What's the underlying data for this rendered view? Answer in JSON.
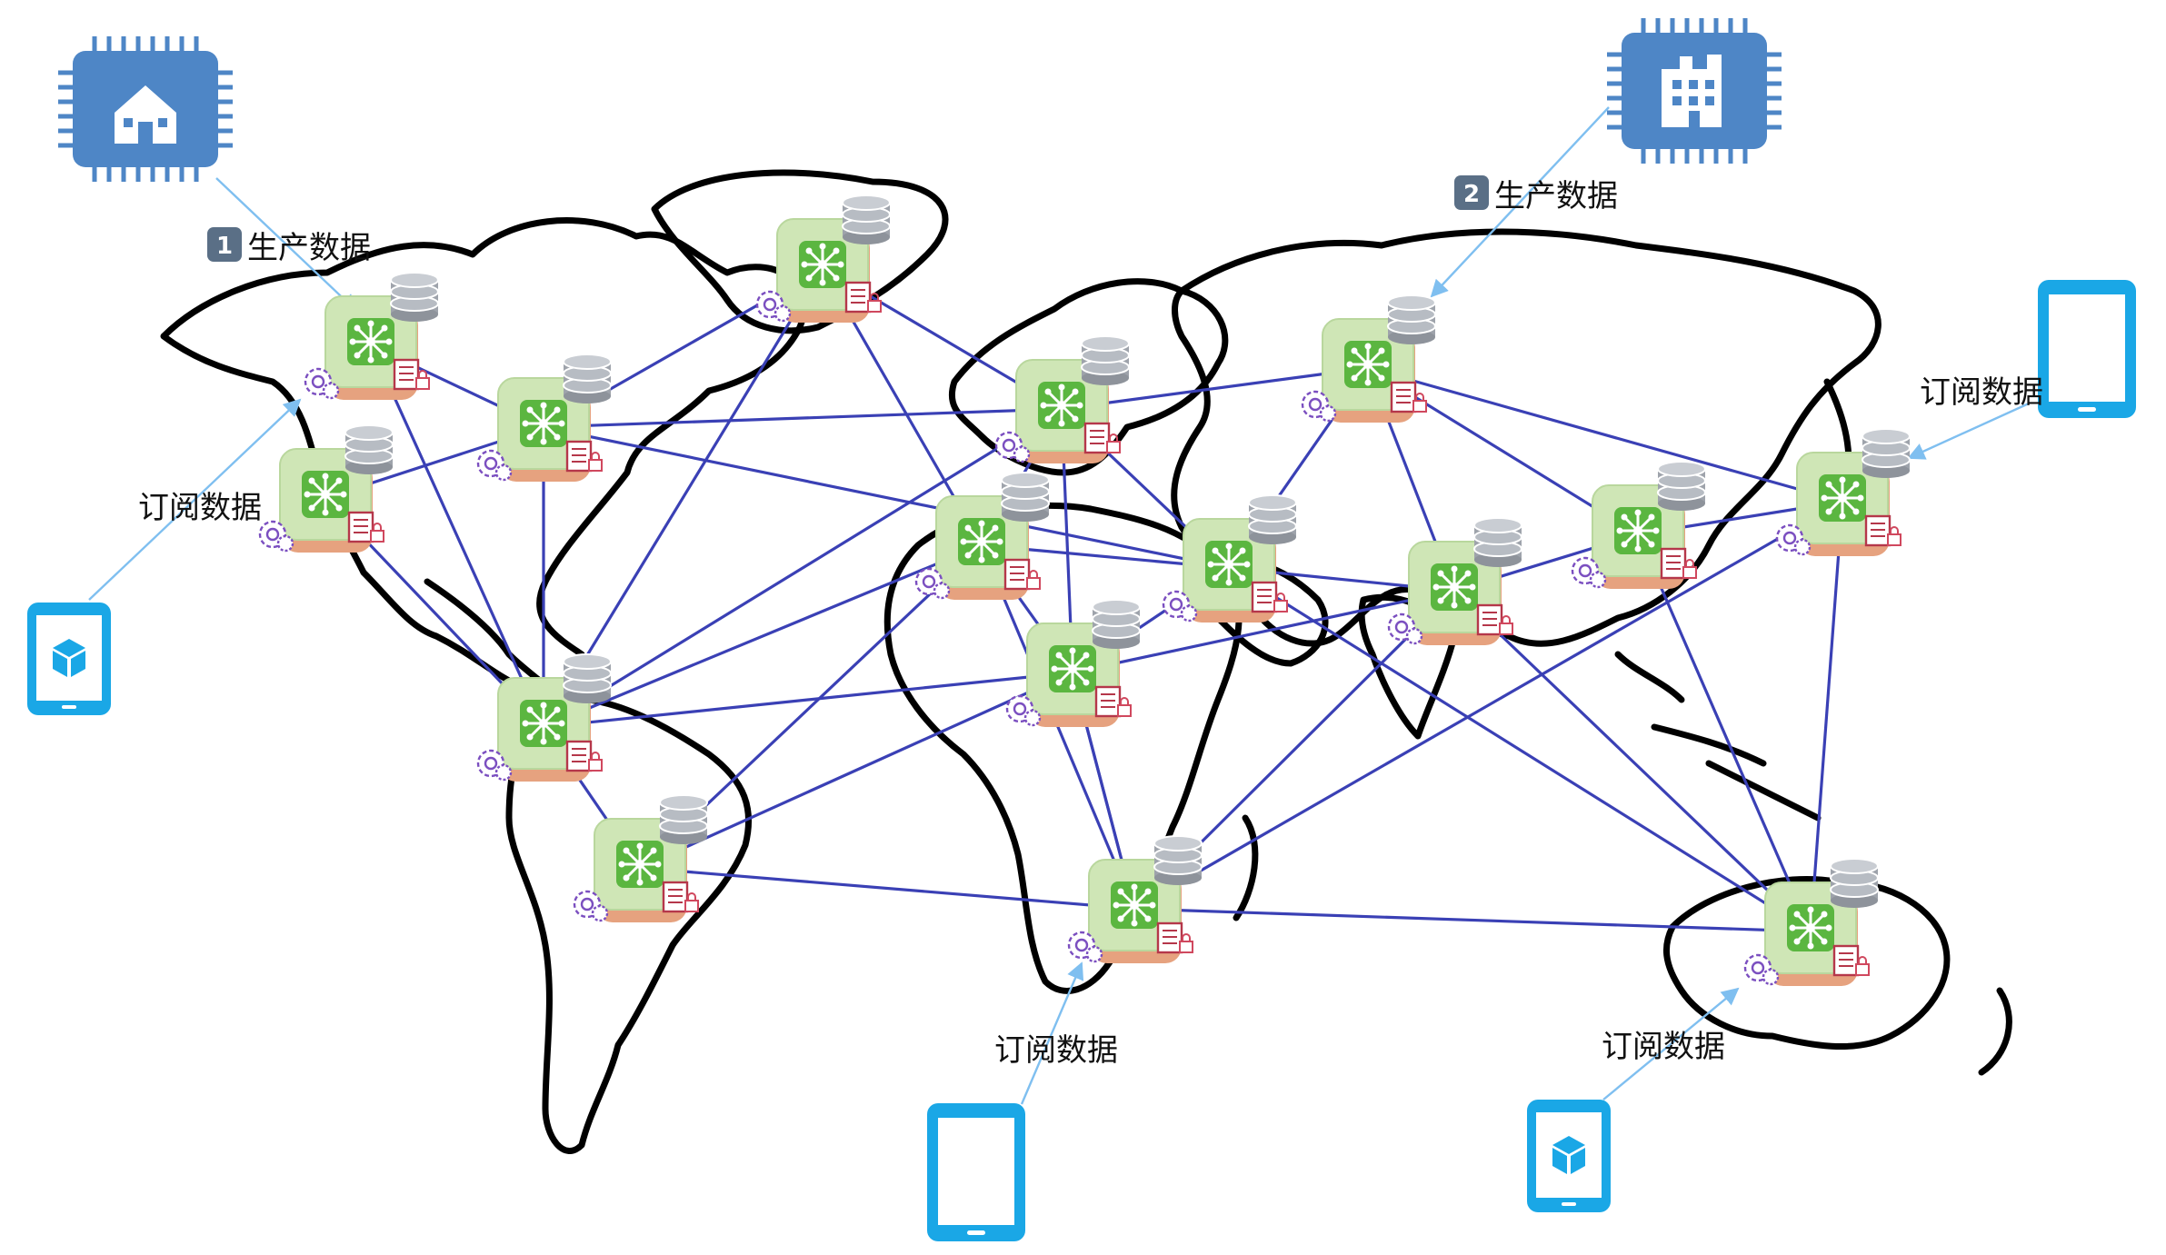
{
  "title": "",
  "colors": {
    "link": "#3a40b5",
    "arrow": "#7fbff0",
    "coast": "#000000",
    "chip": "#4e86c6",
    "phone": "#1aa7e6",
    "node_fill": "#cfe6b6",
    "node_center": "#5bb640",
    "node_base": "#e08a67"
  },
  "producers": [
    {
      "id": "home-chip",
      "icon": "home-chip-icon",
      "badge": "1",
      "label": "生产数据",
      "target": 0
    },
    {
      "id": "factory-chip",
      "icon": "factory-chip-icon",
      "badge": "2",
      "label": "生产数据",
      "target": 8
    }
  ],
  "subscribers": [
    {
      "id": "left-tablet",
      "icon": "cube-tablet-icon",
      "label": "订阅数据",
      "target": 1
    },
    {
      "id": "bottom-phone",
      "icon": "phone-icon",
      "label": "订阅数据",
      "target": 15
    },
    {
      "id": "bottom-tablet",
      "icon": "cube-tablet-icon",
      "label": "订阅数据",
      "target": 16
    },
    {
      "id": "right-phone",
      "icon": "phone-icon",
      "label": "订阅数据",
      "target": 14
    }
  ],
  "nodes": [
    {
      "name": "node-north-america-west"
    },
    {
      "name": "node-north-america-southwest"
    },
    {
      "name": "node-north-america-east"
    },
    {
      "name": "node-greenland"
    },
    {
      "name": "node-central-america"
    },
    {
      "name": "node-south-america"
    },
    {
      "name": "node-europe"
    },
    {
      "name": "node-north-africa"
    },
    {
      "name": "node-russia"
    },
    {
      "name": "node-middle-east"
    },
    {
      "name": "node-central-africa"
    },
    {
      "name": "node-india"
    },
    {
      "name": "node-china"
    },
    {
      "name": "node-east-asia"
    },
    {
      "name": "node-japan"
    },
    {
      "name": "node-south-africa"
    },
    {
      "name": "node-australia"
    }
  ],
  "links": [
    [
      0,
      2
    ],
    [
      0,
      4
    ],
    [
      1,
      4
    ],
    [
      2,
      1
    ],
    [
      2,
      3
    ],
    [
      2,
      4
    ],
    [
      2,
      6
    ],
    [
      2,
      9
    ],
    [
      3,
      6
    ],
    [
      3,
      7
    ],
    [
      3,
      4
    ],
    [
      4,
      5
    ],
    [
      4,
      7
    ],
    [
      4,
      10
    ],
    [
      4,
      6
    ],
    [
      5,
      7
    ],
    [
      5,
      10
    ],
    [
      5,
      15
    ],
    [
      6,
      7
    ],
    [
      6,
      8
    ],
    [
      6,
      9
    ],
    [
      6,
      10
    ],
    [
      7,
      9
    ],
    [
      7,
      10
    ],
    [
      7,
      15
    ],
    [
      10,
      15
    ],
    [
      8,
      9
    ],
    [
      8,
      11
    ],
    [
      8,
      12
    ],
    [
      8,
      14
    ],
    [
      8,
      13
    ],
    [
      9,
      10
    ],
    [
      9,
      11
    ],
    [
      9,
      16
    ],
    [
      10,
      11
    ],
    [
      10,
      15
    ],
    [
      11,
      12
    ],
    [
      11,
      15
    ],
    [
      11,
      16
    ],
    [
      12,
      14
    ],
    [
      12,
      16
    ],
    [
      14,
      16
    ],
    [
      14,
      15
    ],
    [
      12,
      13
    ],
    [
      13,
      16
    ],
    [
      15,
      16
    ],
    [
      16,
      13
    ]
  ]
}
